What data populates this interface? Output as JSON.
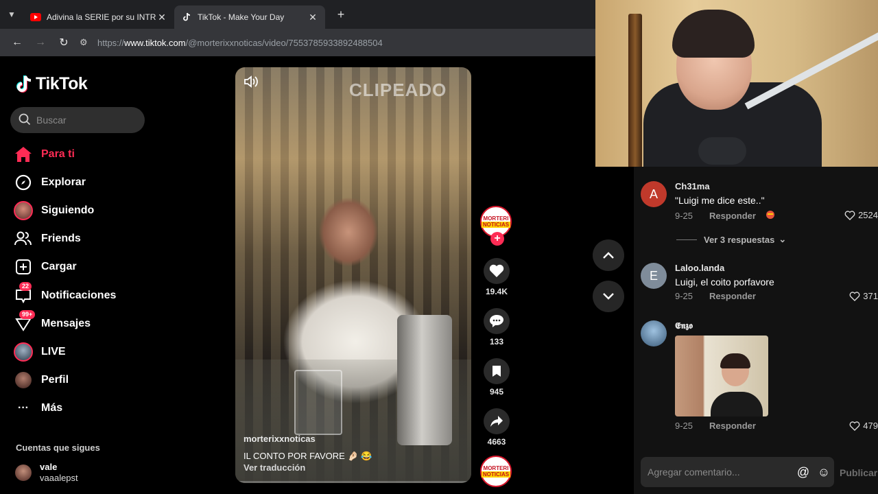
{
  "browser": {
    "tabs": [
      {
        "title": "Adivina la SERIE por su INTRO",
        "favicon": "youtube-icon",
        "active": false
      },
      {
        "title": "TikTok - Make Your Day",
        "favicon": "tiktok-icon",
        "active": true
      }
    ],
    "url_prefix": "https://",
    "url_host": "www.tiktok.com",
    "url_path": "/@morterixxnoticas/video/7553785933892488504"
  },
  "sidebar": {
    "logo": "TikTok",
    "search_placeholder": "Buscar",
    "nav": [
      {
        "label": "Para ti",
        "icon": "home-icon",
        "active": true
      },
      {
        "label": "Explorar",
        "icon": "compass-icon"
      },
      {
        "label": "Siguiendo",
        "icon": "following-avatar"
      },
      {
        "label": "Friends",
        "icon": "friends-icon"
      },
      {
        "label": "Cargar",
        "icon": "upload-icon"
      },
      {
        "label": "Notificaciones",
        "icon": "inbox-icon",
        "badge": "22"
      },
      {
        "label": "Mensajes",
        "icon": "messages-icon",
        "badge": "99+"
      },
      {
        "label": "LIVE",
        "icon": "live-avatar"
      },
      {
        "label": "Perfil",
        "icon": "profile-avatar"
      },
      {
        "label": "Más",
        "icon": "more-icon"
      }
    ],
    "following_title": "Cuentas que sigues",
    "following": [
      {
        "name": "vale",
        "handle": "vaaalepst"
      }
    ]
  },
  "video": {
    "watermark": "CLIPEADO",
    "author": "morterixxnoticas",
    "caption": "IL CONTO POR FAVORE 🤌🏻 😂",
    "translate": "Ver traducción"
  },
  "actions": {
    "creator_line1": "MORTERI",
    "creator_line2": "NOTICIAS",
    "likes": "19.4K",
    "comments": "133",
    "saves": "945",
    "shares": "4663"
  },
  "comments": [
    {
      "initial": "A",
      "avatar_color": "#c0392b",
      "user": "Ch31ma",
      "text": "\"Luigi me dice este..\"",
      "date": "9-25",
      "reply": "Responder",
      "likes": "2524",
      "view_replies": "Ver 3 respuestas"
    },
    {
      "initial": "E",
      "avatar_color": "#7f8c9a",
      "user": "Laloo.landa",
      "text": "Luigi, el coito porfavore",
      "date": "9-25",
      "reply": "Responder",
      "likes": "371"
    },
    {
      "initial": "",
      "avatar_color": "#6a8fb0",
      "user": "𝕰𝖓𝖟𝖔",
      "text": "",
      "date": "9-25",
      "reply": "Responder",
      "likes": "479"
    }
  ],
  "composer": {
    "placeholder": "Agregar comentario...",
    "publish": "Publicar"
  },
  "colors": {
    "accent": "#fe2c55",
    "background": "#000000",
    "panel": "#121212"
  }
}
